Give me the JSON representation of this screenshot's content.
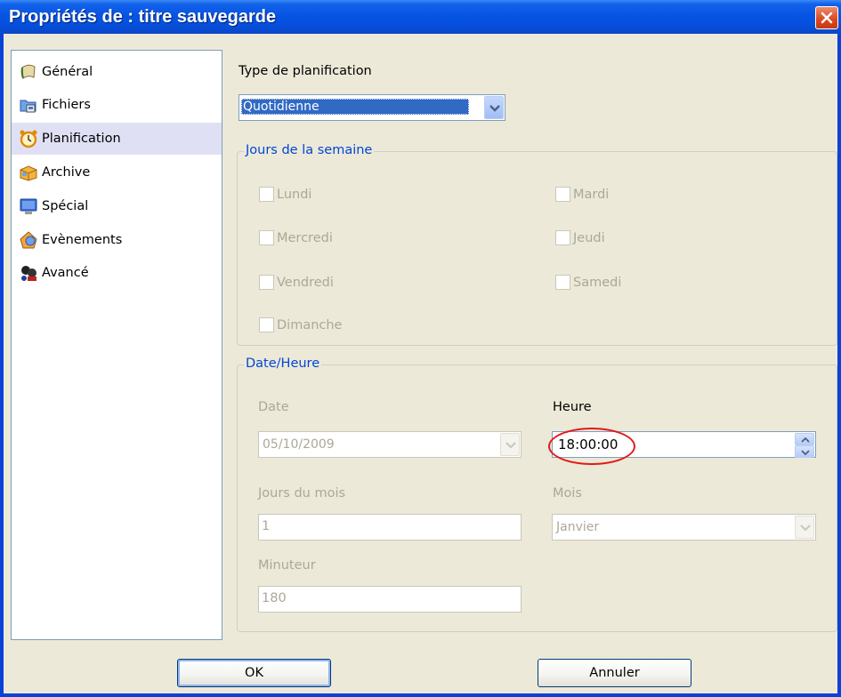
{
  "window": {
    "title": "Propriétés de : titre sauvegarde"
  },
  "nav": {
    "items": [
      {
        "label": "Général",
        "icon": "general-icon"
      },
      {
        "label": "Fichiers",
        "icon": "files-icon"
      },
      {
        "label": "Planification",
        "icon": "alarm-clock-icon",
        "selected": true
      },
      {
        "label": "Archive",
        "icon": "archive-icon"
      },
      {
        "label": "Spécial",
        "icon": "monitor-icon"
      },
      {
        "label": "Evènements",
        "icon": "events-icon"
      },
      {
        "label": "Avancé",
        "icon": "advanced-icon"
      }
    ]
  },
  "schedule": {
    "type_label": "Type de planification",
    "type_value": "Quotidienne"
  },
  "days": {
    "legend": "Jours de la semaine",
    "items": [
      "Lundi",
      "Mardi",
      "Mercredi",
      "Jeudi",
      "Vendredi",
      "Samedi",
      "Dimanche"
    ]
  },
  "datetime": {
    "legend": "Date/Heure",
    "date_label": "Date",
    "date_value": "05/10/2009",
    "time_label": "Heure",
    "time_value": "18:00:00",
    "day_of_month_label": "Jours du mois",
    "day_of_month_value": "1",
    "month_label": "Mois",
    "month_value": "Janvier",
    "timer_label": "Minuteur",
    "timer_value": "180"
  },
  "buttons": {
    "ok": "OK",
    "cancel": "Annuler"
  },
  "colors": {
    "titlebar": "#0754e3",
    "nav_selected": "#e0e0f5",
    "selection": "#316ac5",
    "legend_text": "#0046d5",
    "annotation": "#e21a1a"
  }
}
